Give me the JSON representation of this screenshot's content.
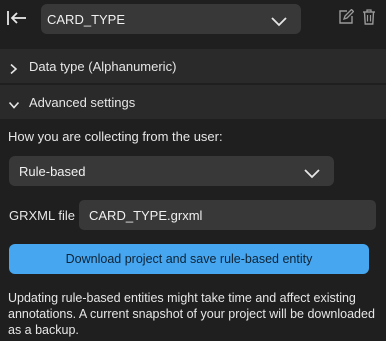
{
  "header": {
    "entity_name": "CARD_TYPE",
    "icons": {
      "back": "collapse-left-icon",
      "dropdown": "chevron-down-icon",
      "edit": "edit-icon",
      "delete": "trash-icon"
    }
  },
  "sections": {
    "data_type": {
      "label": "Data type (Alphanumeric)",
      "expanded": false
    },
    "advanced": {
      "label": "Advanced settings",
      "expanded": true
    }
  },
  "advanced": {
    "collect_label": "How you are collecting from the user:",
    "collection_method": "Rule-based",
    "grxml_label": "GRXML file",
    "grxml_value": "CARD_TYPE.grxml",
    "download_button": "Download project and save rule-based entity",
    "note": "Updating rule-based entities might take time and affect existing annotations. A current snapshot of your project will be downloaded as a backup."
  },
  "colors": {
    "background": "#1f1f1f",
    "section_row": "#2a2a2a",
    "control": "#383838",
    "accent": "#46a7f0"
  }
}
